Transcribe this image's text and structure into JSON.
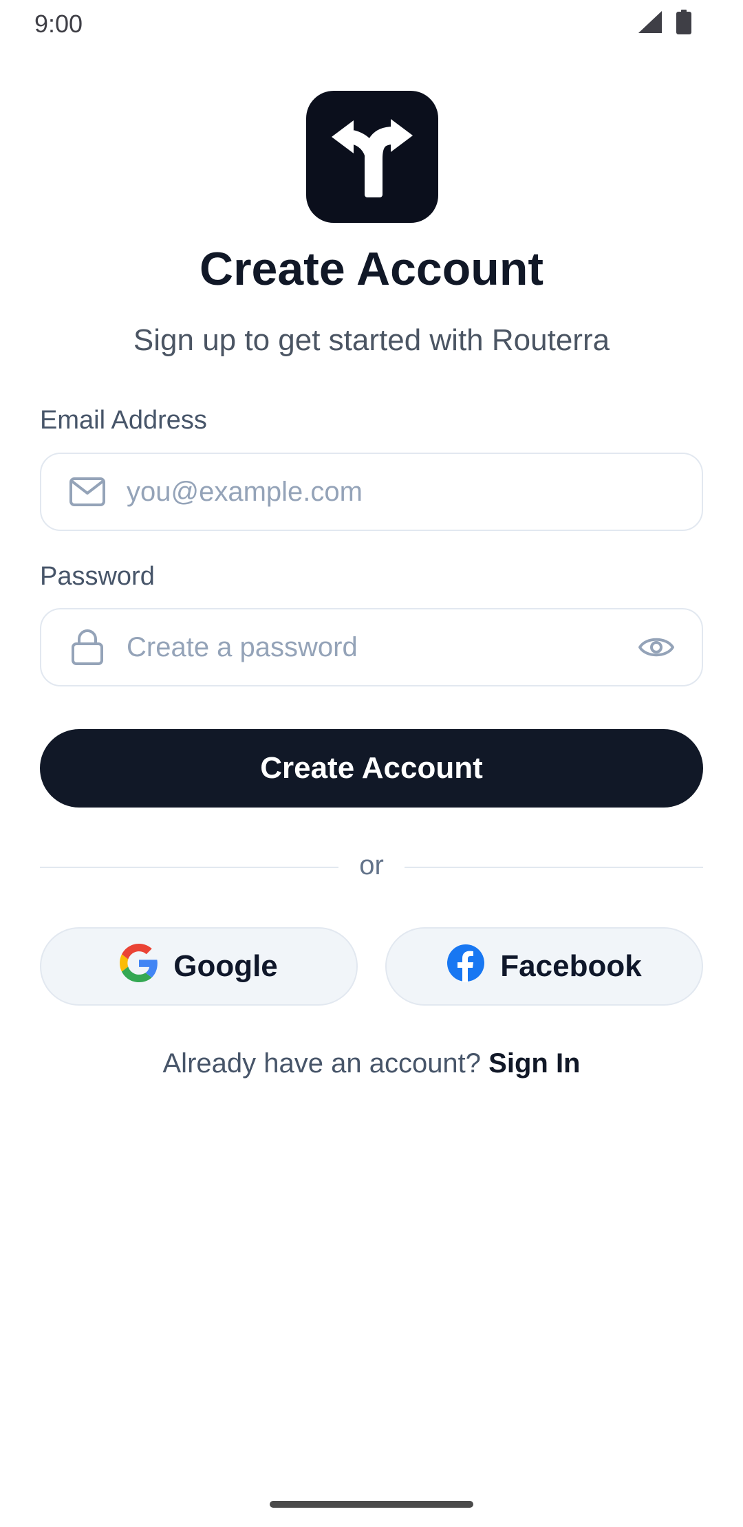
{
  "status_bar": {
    "time": "9:00",
    "signal_icon": "signal-icon",
    "battery_icon": "battery-icon"
  },
  "logo": {
    "icon": "split-arrow-icon",
    "background": "#0b0f1c"
  },
  "header": {
    "title": "Create Account",
    "subtitle": "Sign up to get started with Routerra"
  },
  "form": {
    "email": {
      "label": "Email Address",
      "placeholder": "you@example.com",
      "value": "",
      "icon": "mail-icon"
    },
    "password": {
      "label": "Password",
      "placeholder": "Create a password",
      "value": "",
      "icon": "lock-icon",
      "toggle_icon": "eye-icon"
    },
    "submit_label": "Create Account"
  },
  "divider": {
    "text": "or"
  },
  "social": {
    "google": {
      "label": "Google",
      "icon": "google-icon"
    },
    "facebook": {
      "label": "Facebook",
      "icon": "facebook-icon"
    }
  },
  "footer": {
    "prompt": "Already have an account?",
    "link": "Sign In"
  },
  "colors": {
    "primary": "#111827",
    "border": "#e2e8f0",
    "placeholder": "#94a3b8",
    "social_bg": "#f1f5f9",
    "facebook_blue": "#1877f2"
  }
}
